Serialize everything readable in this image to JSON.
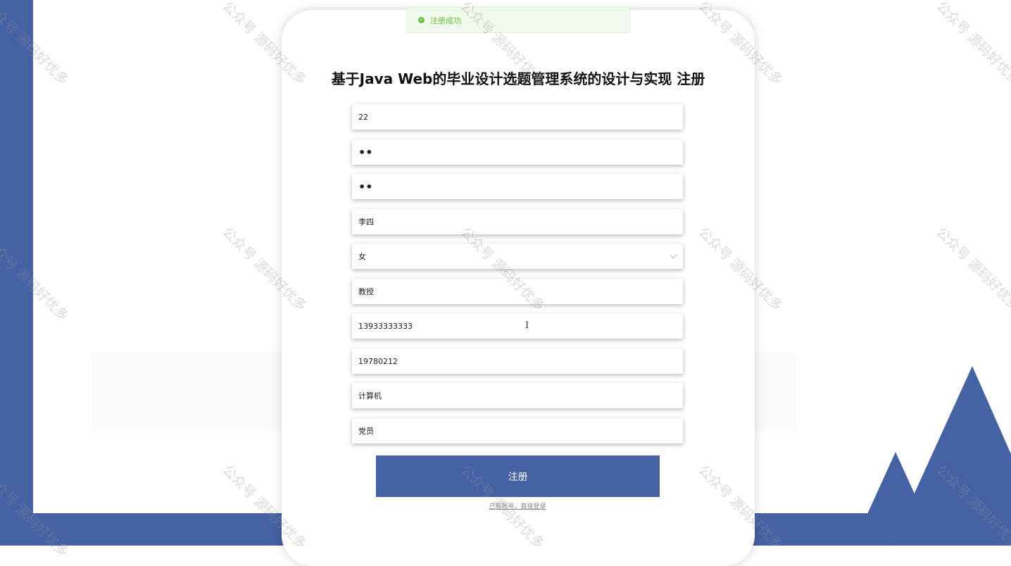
{
  "toast": {
    "icon": "check-circle-icon",
    "message": "注册成功"
  },
  "page": {
    "title": "基于Java Web的毕业设计选题管理系统的设计与实现 注册",
    "submit_label": "注册",
    "login_link": "已有账号，直接登录"
  },
  "form": {
    "account": "22",
    "password": "••",
    "confirm_password": "••",
    "name": "李四",
    "gender": "女",
    "title": "教授",
    "phone": "13933333333",
    "birthday": "19780212",
    "department": "计算机",
    "political_status": "党员"
  },
  "watermark": "公众号 源码好优多",
  "colors": {
    "brand": "#4562a4",
    "success": "#67c23a"
  }
}
